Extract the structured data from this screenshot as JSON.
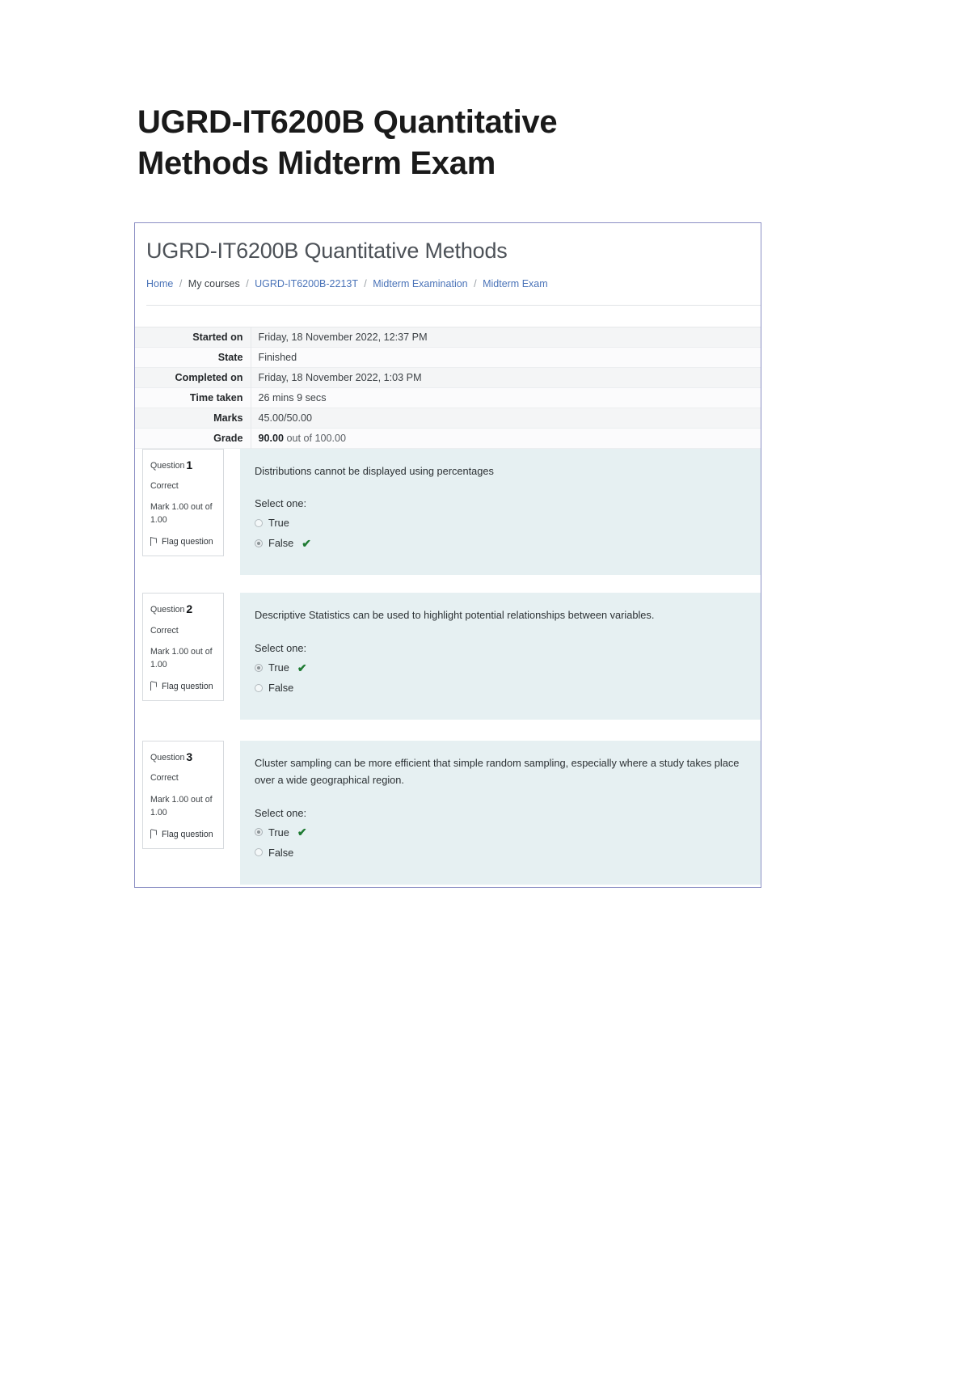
{
  "document": {
    "title": "UGRD-IT6200B Quantitative Methods Midterm Exam"
  },
  "screenshot": {
    "course_title": "UGRD-IT6200B Quantitative Methods",
    "breadcrumb": {
      "items": [
        {
          "label": "Home",
          "link": true
        },
        {
          "label": "My courses",
          "link": false
        },
        {
          "label": "UGRD-IT6200B-2213T",
          "link": true
        },
        {
          "label": "Midterm Examination",
          "link": true
        },
        {
          "label": "Midterm Exam",
          "link": true
        }
      ],
      "separator": "/"
    },
    "attempt_summary": {
      "rows": [
        {
          "label": "Started on",
          "value": "Friday, 18 November 2022, 12:37 PM"
        },
        {
          "label": "State",
          "value": "Finished"
        },
        {
          "label": "Completed on",
          "value": "Friday, 18 November 2022, 1:03 PM"
        },
        {
          "label": "Time taken",
          "value": "26 mins 9 secs"
        },
        {
          "label": "Marks",
          "value": "45.00/50.00"
        }
      ],
      "grade_row": {
        "label": "Grade",
        "value_bold": "90.00",
        "value_rest": " out of 100.00"
      }
    },
    "questions": [
      {
        "number_label": "Question",
        "number": "1",
        "state": "Correct",
        "mark": "Mark 1.00 out of 1.00",
        "flag_label": "Flag question",
        "text": "Distributions cannot be displayed using percentages",
        "select_label": "Select one:",
        "options": [
          {
            "label": "True",
            "selected": false,
            "correct_tick": false
          },
          {
            "label": "False",
            "selected": true,
            "correct_tick": true
          }
        ]
      },
      {
        "number_label": "Question",
        "number": "2",
        "state": "Correct",
        "mark": "Mark 1.00 out of 1.00",
        "flag_label": "Flag question",
        "text": "Descriptive Statistics can be used to highlight potential relationships between variables.",
        "select_label": "Select one:",
        "options": [
          {
            "label": "True",
            "selected": true,
            "correct_tick": true
          },
          {
            "label": "False",
            "selected": false,
            "correct_tick": false
          }
        ]
      },
      {
        "number_label": "Question",
        "number": "3",
        "state": "Correct",
        "mark": "Mark 1.00 out of 1.00",
        "flag_label": "Flag question",
        "text": "Cluster sampling can be more efficient that simple random sampling, especially where a study takes place over a wide geographical region.",
        "select_label": "Select one:",
        "options": [
          {
            "label": "True",
            "selected": true,
            "correct_tick": true
          },
          {
            "label": "False",
            "selected": false,
            "correct_tick": false
          }
        ]
      }
    ]
  },
  "colors": {
    "frame_border": "#8b8fc4",
    "question_body_bg": "#e6f0f2",
    "link": "#4a73b8",
    "tick_green": "#1e7a32"
  }
}
